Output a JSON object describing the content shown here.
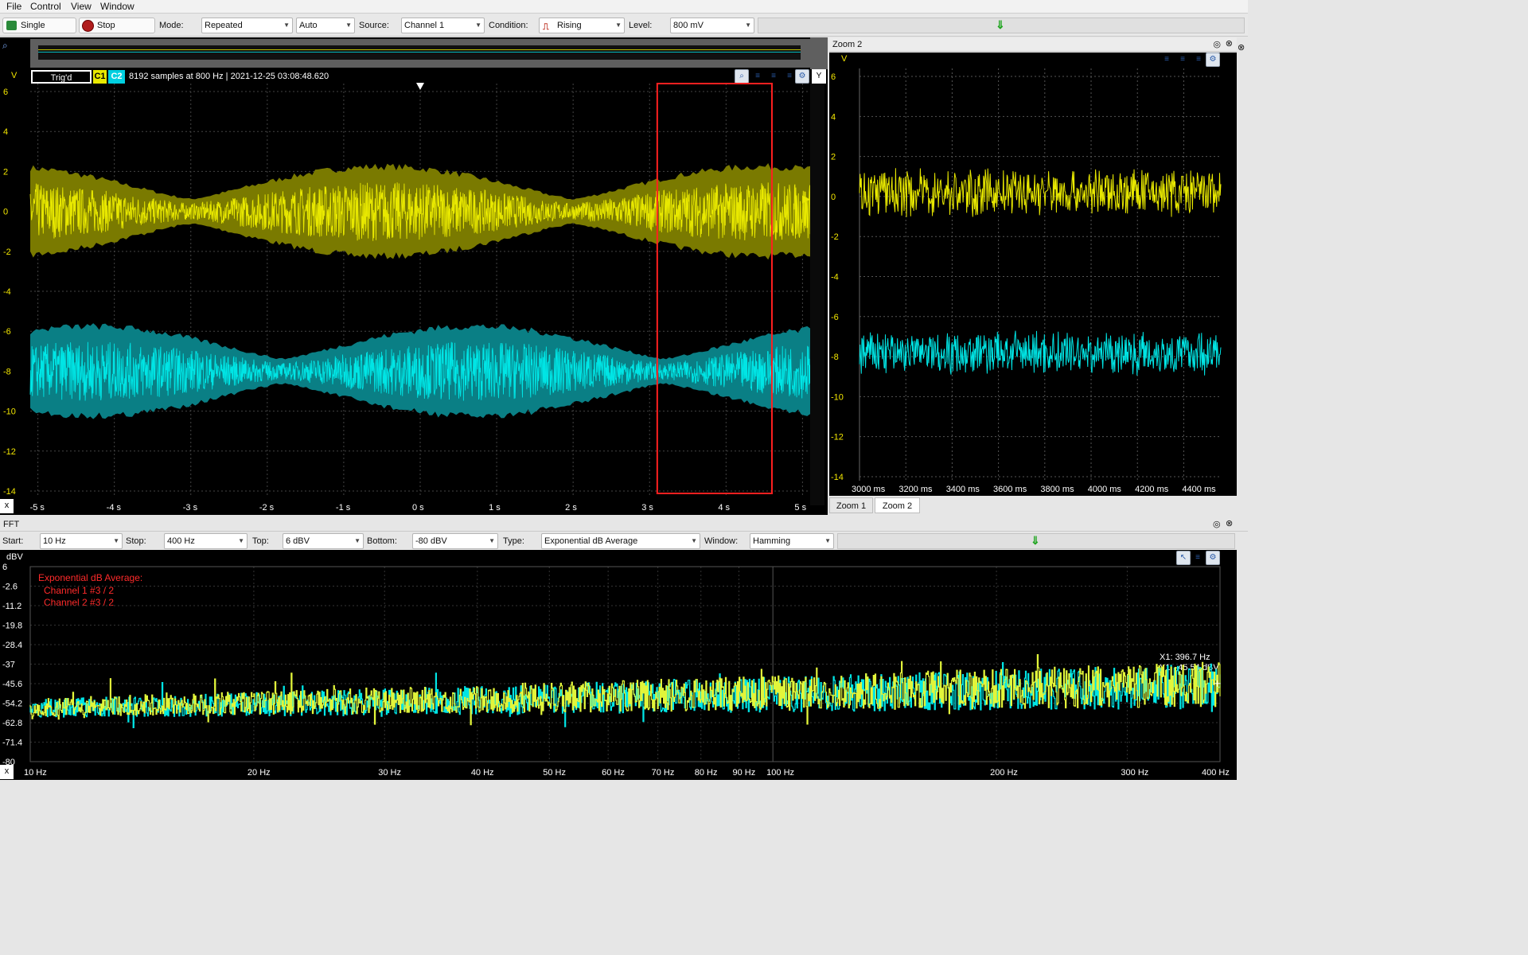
{
  "menu": [
    "File",
    "Control",
    "View",
    "Window"
  ],
  "toolbar": {
    "single_label": "Single",
    "stop_label": "Stop",
    "mode_label": "Mode:",
    "mode_value": "Repeated",
    "auto_value": "Auto",
    "source_label": "Source:",
    "source_value": "Channel 1",
    "condition_label": "Condition:",
    "condition_value": "Rising",
    "level_label": "Level:",
    "level_value": "800 mV",
    "arrow": "⇓"
  },
  "scope": {
    "trig_label": "Trig'd",
    "c1": "C1",
    "c2": "C2",
    "info": "8192 samples at 800 Hz | 2021-12-25 03:08:48.620",
    "y_unit": "V",
    "y_ticks": [
      "6",
      "4",
      "2",
      "0",
      "-2",
      "-4",
      "-6",
      "-8",
      "-10",
      "-12",
      "-14"
    ],
    "x_button": "x",
    "x_ticks": [
      "-5 s",
      "-4 s",
      "-3 s",
      "-2 s",
      "-1 s",
      "0 s",
      "1 s",
      "2 s",
      "3 s",
      "4 s",
      "5 s"
    ],
    "y_button": "Y",
    "close": "✕",
    "selection_start_s": 3.1,
    "selection_end_s": 4.6
  },
  "zoom": {
    "title": "Zoom 2",
    "y_unit": "V",
    "y_ticks": [
      "6",
      "4",
      "2",
      "0",
      "-2",
      "-4",
      "-6",
      "-8",
      "-10",
      "-12",
      "-14"
    ],
    "x_ticks": [
      "3000 ms",
      "3200 ms",
      "3400 ms",
      "3600 ms",
      "3800 ms",
      "4000 ms",
      "4200 ms",
      "4400 ms"
    ],
    "tabs": [
      "Zoom 1",
      "Zoom 2"
    ]
  },
  "fft": {
    "title": "FFT",
    "start_label": "Start:",
    "start_value": "10 Hz",
    "stop_label": "Stop:",
    "stop_value": "400 Hz",
    "top_label": "Top:",
    "top_value": "6 dBV",
    "bottom_label": "Bottom:",
    "bottom_value": "-80 dBV",
    "type_label": "Type:",
    "type_value": "Exponential dB Average",
    "window_label": "Window:",
    "window_value": "Hamming",
    "y_unit": "dBV",
    "y_ticks": [
      "6",
      "-2.6",
      "-11.2",
      "-19.8",
      "-28.4",
      "-37",
      "-45.6",
      "-54.2",
      "-62.8",
      "-71.4",
      "-80"
    ],
    "x_button": "x",
    "x_ticks": [
      "10 Hz",
      "20 Hz",
      "30 Hz",
      "40 Hz",
      "50 Hz",
      "60 Hz",
      "70 Hz",
      "80 Hz",
      "90 Hz",
      "100 Hz",
      "200 Hz",
      "300 Hz",
      "400 Hz"
    ],
    "x_tick_values": [
      10,
      20,
      30,
      40,
      50,
      60,
      70,
      80,
      90,
      100,
      200,
      300,
      400
    ],
    "legend_title": "Exponential dB Average:",
    "legend_ch1": "Channel 1 #3 / 2",
    "legend_ch2": "Channel 2 #3 / 2",
    "cursor_x": "X1: 396.7 Hz",
    "cursor_y": "Y1: -45.54 dBV"
  },
  "colors": {
    "ch1": "#e8e800",
    "ch1_env": "#7a7a00",
    "ch2": "#00e5e5",
    "ch2_env": "#0a7f85",
    "fft": "#e2f53a",
    "selection": "#ff2020",
    "legend_red": "#ff2a2a"
  }
}
